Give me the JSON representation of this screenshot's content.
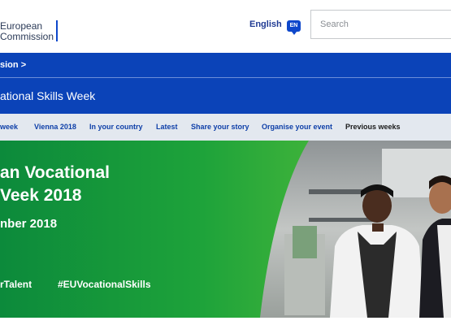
{
  "header": {
    "logo_line1": "European",
    "logo_line2": "Commission",
    "language": "English",
    "language_code": "EN",
    "search_placeholder": "Search"
  },
  "breadcrumb": {
    "label": "sion",
    "chevron": ">"
  },
  "site": {
    "title": "ational Skills Week"
  },
  "nav": {
    "items": [
      {
        "label": "week"
      },
      {
        "label": "Vienna 2018"
      },
      {
        "label": "In your country"
      },
      {
        "label": "Latest"
      },
      {
        "label": "Share your story"
      },
      {
        "label": "Organise your event"
      },
      {
        "label": "Previous weeks"
      }
    ]
  },
  "hero": {
    "title_line1": "an Vocational",
    "title_line2": "Veek 2018",
    "date": "nber 2018",
    "hashtag1": "rTalent",
    "hashtag2": "#EUVocationalSkills"
  },
  "colors": {
    "brand_blue": "#0b43b8",
    "nav_bg": "#e3e8ef",
    "hero_green": "#1ea33a"
  }
}
